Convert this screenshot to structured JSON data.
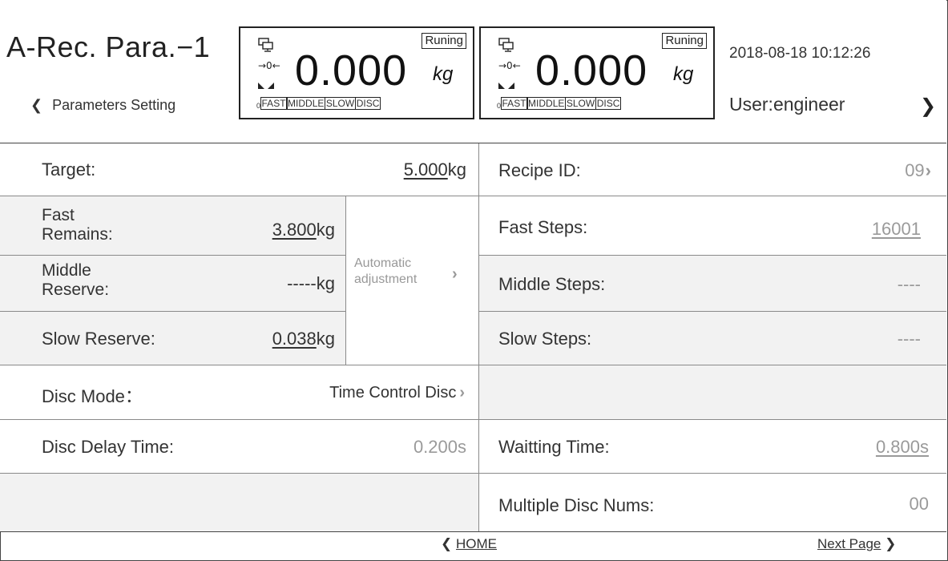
{
  "header": {
    "title": "A-Rec. Para.−1",
    "back_label": "Parameters Setting",
    "back_chevron": "❮",
    "datetime": "2018-08-18 10:12:26",
    "user": "User:engineer",
    "user_chevron": "❯"
  },
  "scales": [
    {
      "status": "Runing",
      "weight": "0.000",
      "unit": "kg",
      "zero_sign": "→0←",
      "step_zero": "0",
      "steps": [
        "FAST",
        "MIDDLE",
        "SLOW",
        "DISC"
      ]
    },
    {
      "status": "Runing",
      "weight": "0.000",
      "unit": "kg",
      "zero_sign": "→0←",
      "step_zero": "0",
      "steps": [
        "FAST",
        "MIDDLE",
        "SLOW",
        "DISC"
      ]
    }
  ],
  "left": {
    "target_label": "Target:",
    "target_value": "5.000",
    "target_unit": "kg",
    "fast_remains_label_1": "Fast",
    "fast_remains_label_2": "Remains:",
    "fast_remains_value": "3.800",
    "fast_remains_unit": "kg",
    "middle_reserve_label_1": "Middle",
    "middle_reserve_label_2": "Reserve:",
    "middle_reserve_value": "-----",
    "middle_reserve_unit": "kg",
    "slow_reserve_label": "Slow Reserve:",
    "slow_reserve_value": "0.038",
    "slow_reserve_unit": "kg",
    "auto_adjust_1": "Automatic",
    "auto_adjust_2": "adjustment",
    "auto_adjust_chevron": "›",
    "disc_mode_label": "Disc  Mode：",
    "disc_mode_value": "Time Control Disc",
    "disc_mode_chevron": "›",
    "disc_delay_label": "Disc Delay Time:",
    "disc_delay_value": "0.200s"
  },
  "right": {
    "recipe_id_label": "Recipe ID:",
    "recipe_id_value": "09",
    "recipe_id_chevron": "›",
    "fast_steps_label": "Fast Steps:",
    "fast_steps_value": "16001",
    "middle_steps_label": "Middle Steps:",
    "middle_steps_value": "----",
    "slow_steps_label": "Slow Steps:",
    "slow_steps_value": "----",
    "waiting_time_label": "Waitting Time:",
    "waiting_time_value": "0.800s",
    "multi_disc_label": "Multiple Disc Nums:",
    "multi_disc_value": "00"
  },
  "footer": {
    "home_chevron": "❮",
    "home_label": "HOME",
    "next_label": "Next Page",
    "next_chevron": "❯"
  },
  "colors": {
    "gray_row": "#f2f2f2",
    "grid_line": "#8a8a8a",
    "muted_text": "#9a9a9a"
  }
}
